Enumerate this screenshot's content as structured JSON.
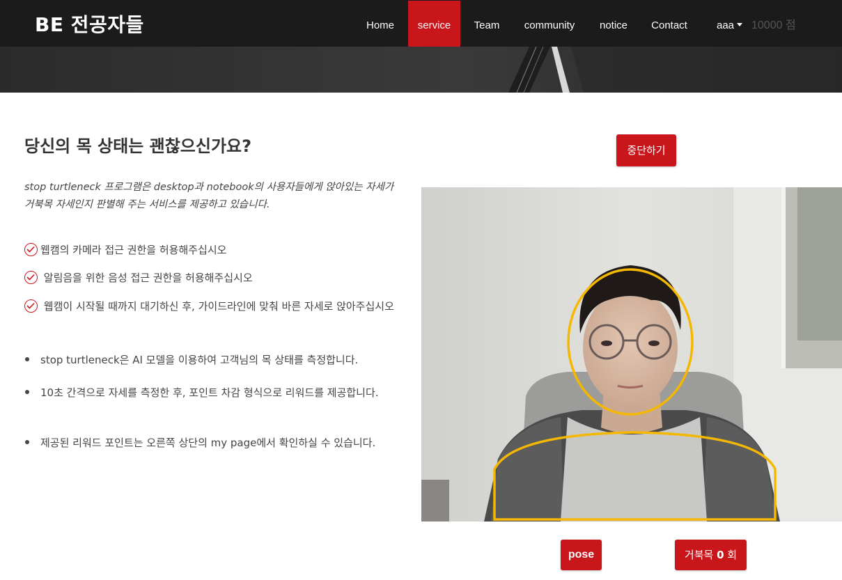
{
  "navbar": {
    "brand": "BE 전공자들",
    "items": [
      {
        "label": "Home"
      },
      {
        "label": "service"
      },
      {
        "label": "Team"
      },
      {
        "label": "community"
      },
      {
        "label": "notice"
      },
      {
        "label": "Contact"
      }
    ],
    "active_item": "service",
    "user": "aaa",
    "points": "10000 점"
  },
  "main": {
    "title": "당신의 목 상태는 괜찮으신가요?",
    "intro": "stop turtleneck 프로그램은 desktop과 notebook의 사용자들에게 앉아있는 자세가 거북목 자세인지 판별해 주는 서비스를 제공하고 있습니다.",
    "checklist": [
      "웹캠의 카메라 접근 권한을 허용해주십시오",
      "알림음을 위한 음성 접근 권한을 허용해주십시오",
      "웹캠이 시작될 때까지 대기하신 후, 가이드라인에 맞춰 바른 자세로 앉아주십시오"
    ],
    "bullets": [
      "stop turtleneck은 AI 모델을 이용하여 고객님의 목 상태를 측정합니다.",
      "10초 간격으로 자세를 측정한 후, 포인트 차감 형식으로 리워드를 제공합니다.",
      "제공된 리워드 포인트는 오른쪽 상단의 my page에서 확인하실 수 있습니다."
    ]
  },
  "controls": {
    "stop_label": "중단하기",
    "pose_label": "pose",
    "turtle_prefix": "거북목",
    "turtle_count": "0",
    "turtle_suffix": "회"
  },
  "colors": {
    "accent": "#c9161b",
    "navbar": "#1b1b1b",
    "guide": "#f5b800"
  },
  "icons": {
    "check": "check-circle-icon",
    "bullet": "bullet-dot"
  }
}
